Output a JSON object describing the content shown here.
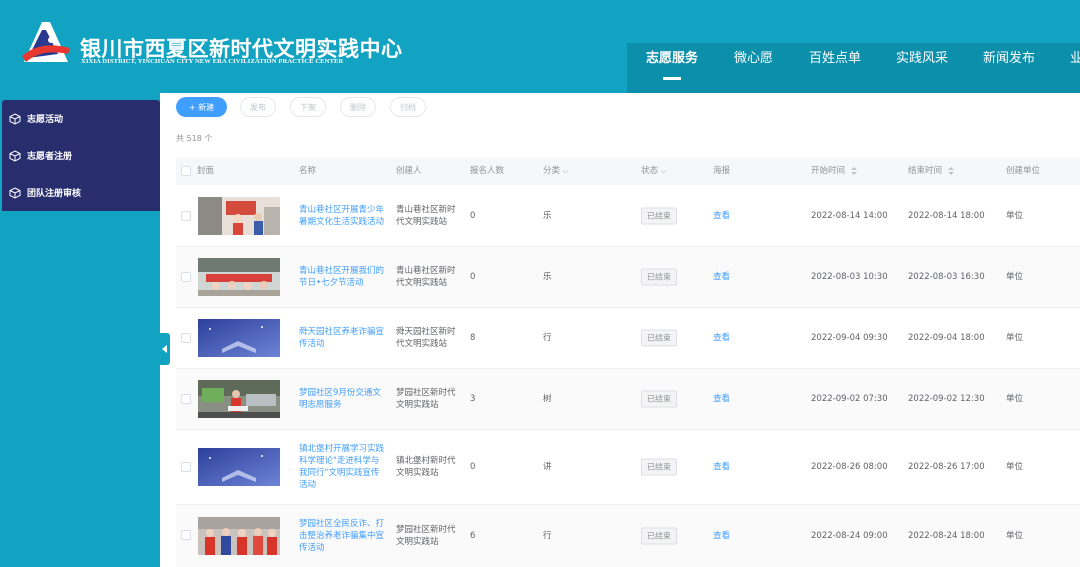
{
  "header": {
    "title": "银川市西夏区新时代文明实践中心",
    "subtitle": "XIXIA DISTRICT, YINCHUAN CITY NEW ERA CIVILIZATION PRACTICE CENTER",
    "nav": [
      {
        "label": "志愿服务",
        "active": true
      },
      {
        "label": "微心愿",
        "active": false
      },
      {
        "label": "百姓点单",
        "active": false
      },
      {
        "label": "实践风采",
        "active": false
      },
      {
        "label": "新闻发布",
        "active": false
      },
      {
        "label": "业",
        "active": false
      }
    ]
  },
  "sidebar": {
    "items": [
      {
        "label": "志愿活动",
        "icon": "cube-icon"
      },
      {
        "label": "志愿者注册",
        "icon": "cube-icon"
      },
      {
        "label": "团队注册审核",
        "icon": "cube-icon"
      }
    ]
  },
  "toolbar": {
    "new_label": "+ 新建",
    "publish_label": "发布",
    "offline_label": "下架",
    "delete_label": "删除",
    "archive_label": "归档"
  },
  "count_label": "共 518 个",
  "table": {
    "columns": [
      "封面",
      "名称",
      "创建人",
      "报名人数",
      "分类",
      "状态",
      "海报",
      "开始时间",
      "结束时间",
      "创建单位"
    ],
    "rows": [
      {
        "name": "青山巷社区开展青少年暑期文化生活实践活动",
        "creator": "青山巷社区新时代文明实践站",
        "signups": "0",
        "category": "乐",
        "status": "已结束",
        "poster": "查看",
        "start": "2022-08-14 14:00",
        "end": "2022-08-14 18:00",
        "unit": "单位"
      },
      {
        "name": "青山巷社区开展我们的节日•七夕节活动",
        "creator": "青山巷社区新时代文明实践站",
        "signups": "0",
        "category": "乐",
        "status": "已结束",
        "poster": "查看",
        "start": "2022-08-03 10:30",
        "end": "2022-08-03 16:30",
        "unit": "单位"
      },
      {
        "name": "舜天园社区养老诈骗宣传活动",
        "creator": "舜天园社区新时代文明实践站",
        "signups": "8",
        "category": "行",
        "status": "已结束",
        "poster": "查看",
        "start": "2022-09-04 09:30",
        "end": "2022-09-04 18:00",
        "unit": "单位"
      },
      {
        "name": "梦园社区9月份交通文明志愿服务",
        "creator": "梦园社区新时代文明实践站",
        "signups": "3",
        "category": "树",
        "status": "已结束",
        "poster": "查看",
        "start": "2022-09-02 07:30",
        "end": "2022-09-02 12:30",
        "unit": "单位"
      },
      {
        "name": "镇北堡村开展学习实践科学理论\"走进科学与我同行\"文明实践宣传活动",
        "creator": "镇北堡村新时代文明实践站",
        "signups": "0",
        "category": "讲",
        "status": "已结束",
        "poster": "查看",
        "start": "2022-08-26 08:00",
        "end": "2022-08-26 17:00",
        "unit": "单位"
      },
      {
        "name": "梦园社区全民反诈、打击整治养老诈骗集中宣传活动",
        "creator": "梦园社区新时代文明实践站",
        "signups": "6",
        "category": "行",
        "status": "已结束",
        "poster": "查看",
        "start": "2022-08-24 09:00",
        "end": "2022-08-24 18:00",
        "unit": "单位"
      }
    ]
  },
  "colors": {
    "brand": "#13a3c2",
    "sidebar_menu": "#282d6e",
    "link": "#409eff",
    "primary_button": "#409eff"
  }
}
